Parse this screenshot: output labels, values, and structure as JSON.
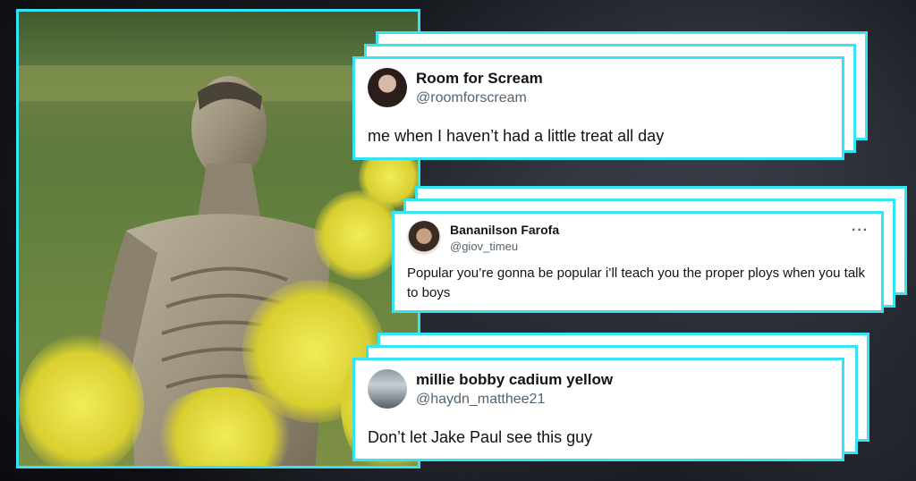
{
  "tweets": [
    {
      "name": "Room for Scream",
      "handle": "@roomforscream",
      "text": "me when I haven’t had a little treat all day"
    },
    {
      "name": "Bananilson Farofa",
      "handle": "@giov_timeu",
      "text": "Popular you’re gonna be popular i’ll teach you the proper ploys when you talk to boys",
      "menu": "···"
    },
    {
      "name": "millie bobby cadium yellow",
      "handle": "@haydn_matthee21",
      "text": "Don’t let Jake Paul see this guy"
    }
  ],
  "colors": {
    "accent": "#35e4f2",
    "text": "#0f1419",
    "muted": "#536471"
  },
  "icons": {
    "menu": "more-horizontal-icon"
  }
}
